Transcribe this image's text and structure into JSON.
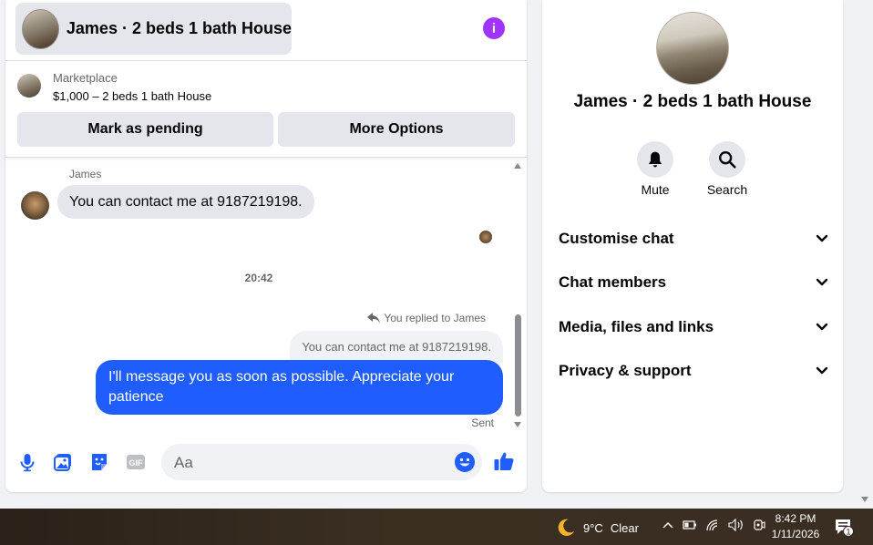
{
  "header": {
    "title": "James · 2 beds 1 bath House",
    "info_icon": "info-icon"
  },
  "listing": {
    "label": "Marketplace",
    "price_title": "$1,000 – 2 beds 1 bath House",
    "pending_button": "Mark as pending",
    "more_button": "More Options"
  },
  "messages": {
    "sender_name": "James",
    "incoming_text": "You can contact me at 9187219198.",
    "time_separator": "20:42",
    "replied_to": "You replied to James",
    "quoted_text": "You can contact me at 9187219198.",
    "outgoing_text": "I'll message you as soon as possible. Appreciate your patience",
    "status": "Sent"
  },
  "composer": {
    "placeholder": "Aa",
    "icons": [
      "microphone-icon",
      "image-icon",
      "sticker-icon",
      "gif-icon",
      "emoji-icon",
      "thumbs-up-icon"
    ]
  },
  "info_panel": {
    "title": "James · 2 beds 1 bath House",
    "actions": [
      {
        "label": "Mute",
        "icon": "bell-icon"
      },
      {
        "label": "Search",
        "icon": "search-icon"
      }
    ],
    "sections": [
      {
        "label": "Customise chat"
      },
      {
        "label": "Chat members"
      },
      {
        "label": "Media, files and links"
      },
      {
        "label": "Privacy & support"
      }
    ]
  },
  "taskbar": {
    "weather_temp": "9°C",
    "weather_desc": "Clear",
    "time": "8:42 PM",
    "date": "1/11/2026",
    "notification_count": "1"
  },
  "colors": {
    "accent_blue": "#1f5dff",
    "info_purple": "#a033ff",
    "bubble_gray": "#e4e6eb"
  }
}
